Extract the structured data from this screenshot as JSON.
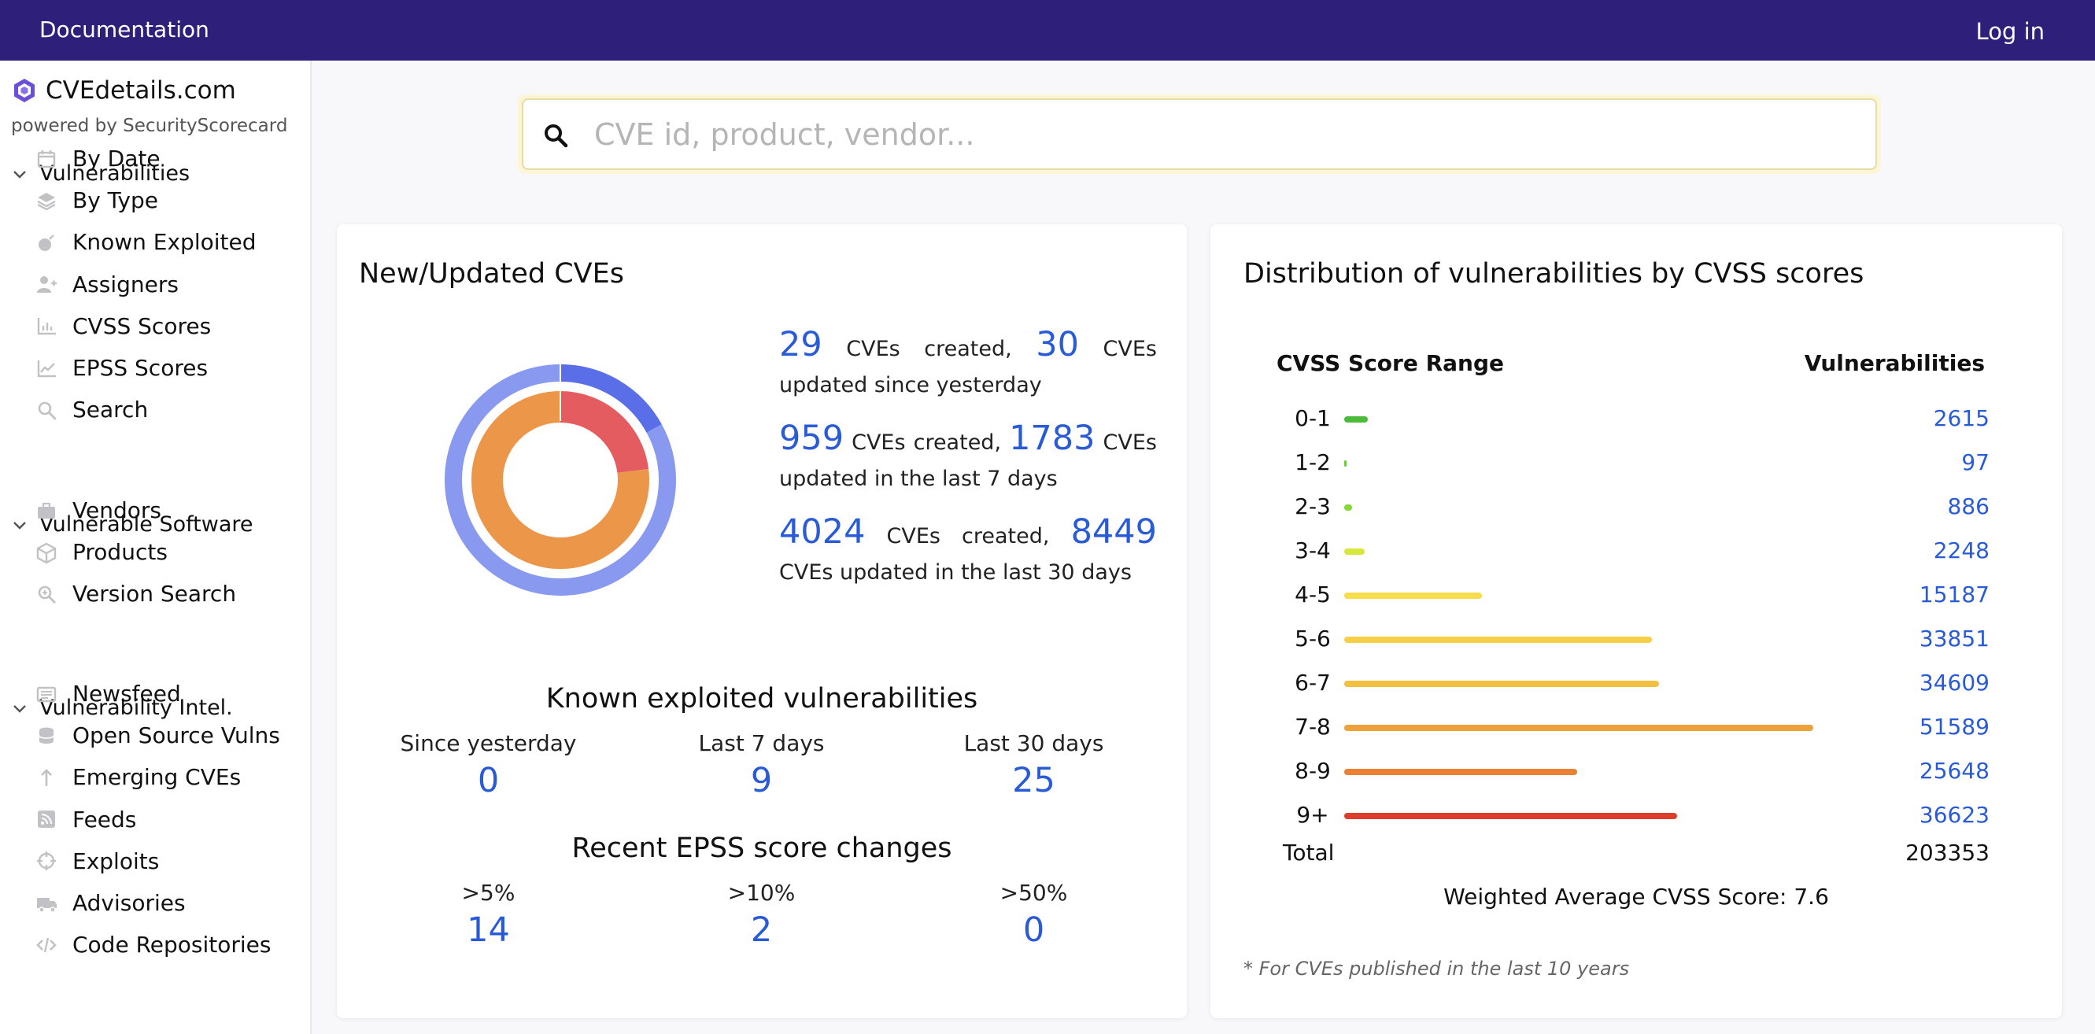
{
  "topbar": {
    "documentation": "Documentation",
    "login": "Log in"
  },
  "brand": {
    "name": "CVEdetails.com",
    "powered": "powered by SecurityScorecard"
  },
  "sidebar": {
    "sections": [
      {
        "title": "Vulnerabilities",
        "items": [
          {
            "label": "By Date",
            "icon": "calendar-icon"
          },
          {
            "label": "By Type",
            "icon": "layers-icon"
          },
          {
            "label": "Known Exploited",
            "icon": "bomb-icon"
          },
          {
            "label": "Assigners",
            "icon": "user-plus-icon"
          },
          {
            "label": "CVSS Scores",
            "icon": "bar-chart-icon"
          },
          {
            "label": "EPSS Scores",
            "icon": "line-chart-icon"
          },
          {
            "label": "Search",
            "icon": "search-icon"
          }
        ]
      },
      {
        "title": "Vulnerable Software",
        "items": [
          {
            "label": "Vendors",
            "icon": "briefcase-icon"
          },
          {
            "label": "Products",
            "icon": "box-icon"
          },
          {
            "label": "Version Search",
            "icon": "zoom-search-icon"
          }
        ]
      },
      {
        "title": "Vulnerability Intel.",
        "items": [
          {
            "label": "Newsfeed",
            "icon": "newspaper-icon"
          },
          {
            "label": "Open Source Vulns",
            "icon": "database-icon"
          },
          {
            "label": "Emerging CVEs",
            "icon": "arrow-up-icon"
          },
          {
            "label": "Feeds",
            "icon": "rss-icon"
          },
          {
            "label": "Exploits",
            "icon": "crosshair-icon"
          },
          {
            "label": "Advisories",
            "icon": "truck-icon"
          },
          {
            "label": "Code Repositories",
            "icon": "code-icon"
          }
        ]
      }
    ]
  },
  "search": {
    "placeholder": "CVE id, product, vendor..."
  },
  "new_updated": {
    "title": "New/Updated CVEs",
    "rows": [
      {
        "created": "29",
        "updated": "30",
        "created_word": "CVEs",
        "mid_word": "created,",
        "updated_word": "CVEs",
        "tail": "updated since yesterday"
      },
      {
        "created": "959",
        "updated": "1783",
        "created_word": "CVEs",
        "mid_word": "created,",
        "updated_word": "CVEs",
        "tail": "updated in the last 7 days"
      },
      {
        "created": "4024",
        "updated": "8449",
        "created_word": "CVEs",
        "mid_word": "created,",
        "updated_word": "",
        "tail": "CVEs updated in the last 30 days"
      }
    ],
    "donut": {
      "outer": [
        {
          "value": 0.17,
          "color": "#5a6ee8"
        },
        {
          "value": 0.83,
          "color": "#8899ef"
        }
      ],
      "inner": [
        {
          "value": 0.23,
          "color": "#e45b60"
        },
        {
          "value": 0.77,
          "color": "#ec964a"
        }
      ]
    }
  },
  "kev": {
    "title": "Known exploited vulnerabilities",
    "cols": [
      {
        "label": "Since yesterday",
        "value": "0"
      },
      {
        "label": "Last 7 days",
        "value": "9"
      },
      {
        "label": "Last 30 days",
        "value": "25"
      }
    ]
  },
  "epss": {
    "title": "Recent EPSS score changes",
    "cols": [
      {
        "label": ">5%",
        "value": "14"
      },
      {
        "label": ">10%",
        "value": "2"
      },
      {
        "label": ">50%",
        "value": "0"
      }
    ]
  },
  "distribution": {
    "title": "Distribution of vulnerabilities by CVSS scores",
    "col_range": "CVSS Score Range",
    "col_vulns": "Vulnerabilities",
    "rows": [
      {
        "range": "0-1",
        "value": 2615,
        "display": "2615",
        "color": "#4cbb3c"
      },
      {
        "range": "1-2",
        "value": 97,
        "display": "97",
        "color": "#6ccc3a"
      },
      {
        "range": "2-3",
        "value": 886,
        "display": "886",
        "color": "#86d834"
      },
      {
        "range": "3-4",
        "value": 2248,
        "display": "2248",
        "color": "#d8e83a"
      },
      {
        "range": "4-5",
        "value": 15187,
        "display": "15187",
        "color": "#f7dc4c"
      },
      {
        "range": "5-6",
        "value": 33851,
        "display": "33851",
        "color": "#f6cf46"
      },
      {
        "range": "6-7",
        "value": 34609,
        "display": "34609",
        "color": "#f3bf3e"
      },
      {
        "range": "7-8",
        "value": 51589,
        "display": "51589",
        "color": "#eea23a"
      },
      {
        "range": "8-9",
        "value": 25648,
        "display": "25648",
        "color": "#eb7f32"
      },
      {
        "range": "9+",
        "value": 36623,
        "display": "36623",
        "color": "#df3d2c"
      }
    ],
    "total_label": "Total",
    "total": "203353",
    "weighted": "Weighted Average CVSS Score: 7.6",
    "footnote": "* For CVEs published in the last 10 years"
  }
}
